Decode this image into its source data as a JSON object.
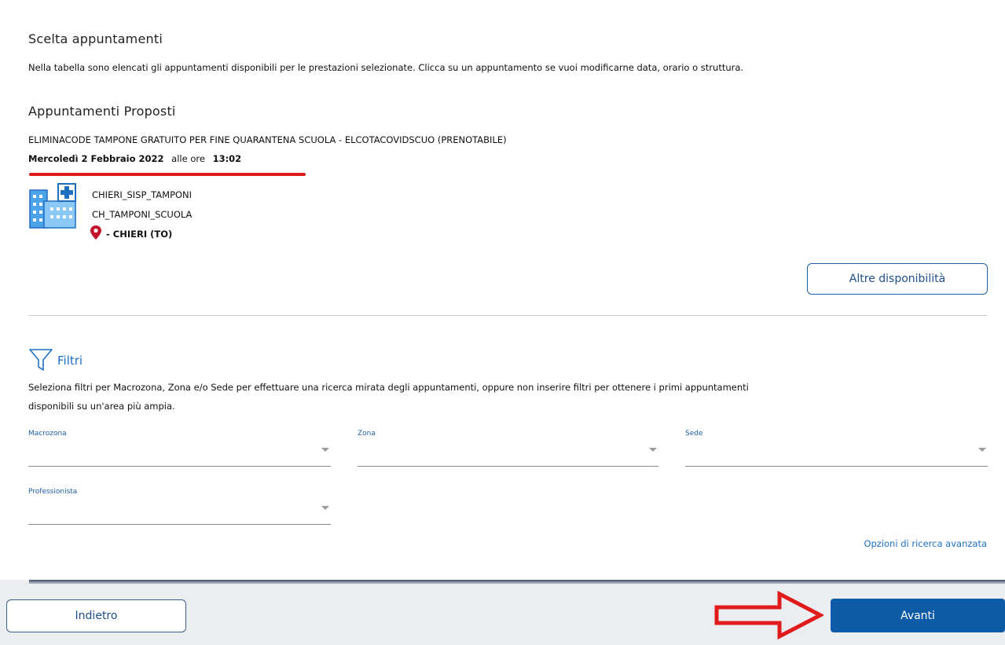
{
  "section": {
    "title": "Scelta appuntamenti",
    "description": "Nella tabella sono elencati gli appuntamenti disponibili per le prestazioni selezionate. Clicca su un appuntamento se vuoi modificarne data, orario o struttura."
  },
  "proposed": {
    "title": "Appuntamenti Proposti",
    "service": "ELIMINACODE TAMPONE GRATUITO PER FINE QUARANTENA SCUOLA - ELCOTACOVIDSCUO (PRENOTABILE)",
    "date": "Mercoledì 2 Febbraio 2022",
    "time_prefix": "alle ore",
    "time": "13:02",
    "facility_line1": "CHIERI_SISP_TAMPONI",
    "facility_line2": "CH_TAMPONI_SCUOLA",
    "location": "- CHIERI (TO)",
    "other_availability_label": "Altre disponibilità"
  },
  "filters": {
    "title": "Filtri",
    "description_line1": "Seleziona filtri per Macrozona, Zona e/o Sede per effettuare una ricerca mirata degli appuntamenti, oppure non inserire filtri per ottenere i primi appuntamenti",
    "description_line2": "disponibili su un'area più ampia.",
    "macrozona_label": "Macrozona",
    "zona_label": "Zona",
    "sede_label": "Sede",
    "professionista_label": "Professionista",
    "advanced_search_label": "Opzioni di ricerca avanzata"
  },
  "footer": {
    "back_label": "Indietro",
    "next_label": "Avanti"
  },
  "colors": {
    "primary": "#0d5aa7",
    "annotation_red": "#e01b1b"
  }
}
